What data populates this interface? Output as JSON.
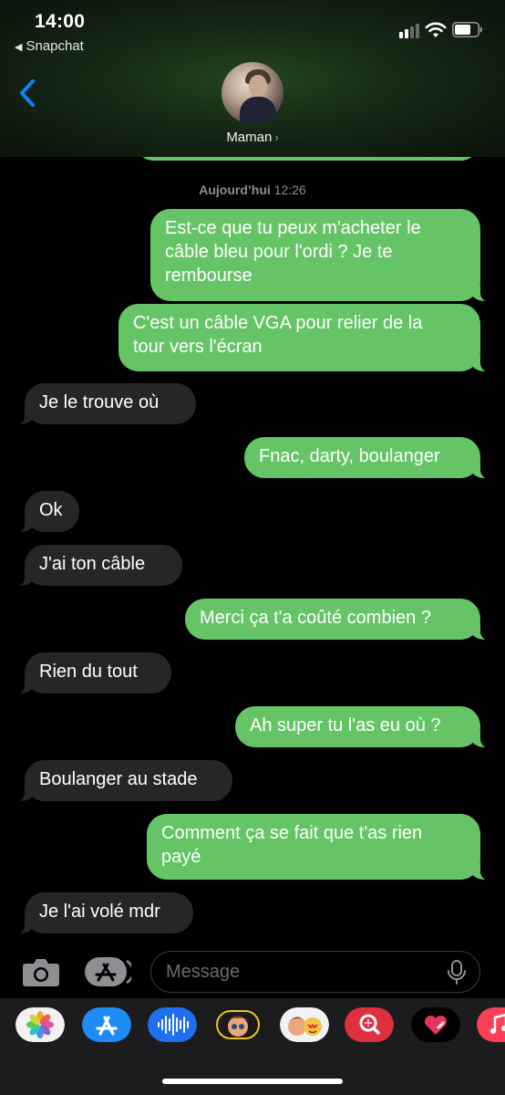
{
  "status_bar": {
    "time": "14:00",
    "back_app": "Snapchat"
  },
  "header": {
    "contact_name": "Maman",
    "chevron": "›"
  },
  "thread": {
    "timestamp_day": "Aujourd’hui",
    "timestamp_time": "12:26",
    "messages": [
      {
        "from": "me",
        "text": "Est-ce que tu peux m'acheter le\ncâble bleu pour l'ordi ? Je te\nrembourse"
      },
      {
        "from": "me",
        "text": "C'est un câble VGA pour relier de la\ntour vers l'écran"
      },
      {
        "from": "them",
        "text": "Je le trouve où"
      },
      {
        "from": "me",
        "text": "Fnac, darty, boulanger"
      },
      {
        "from": "them",
        "text": "Ok"
      },
      {
        "from": "them",
        "text": "J'ai ton câble"
      },
      {
        "from": "me",
        "text": "Merci ça t'a coûté combien ?"
      },
      {
        "from": "them",
        "text": "Rien du tout"
      },
      {
        "from": "me",
        "text": "Ah super tu l'as eu où ?"
      },
      {
        "from": "them",
        "text": "Boulanger au stade"
      },
      {
        "from": "me",
        "text": "Comment ça se fait que t'as rien\npayé"
      },
      {
        "from": "them",
        "text": "Je l'ai volé mdr"
      }
    ]
  },
  "input_bar": {
    "placeholder": "Message"
  },
  "app_drawer": {
    "apps": [
      "photos-icon",
      "app-store-icon",
      "audio-message-icon",
      "memoji-icon",
      "memoji-stickers-icon",
      "web-search-icon",
      "digital-touch-icon",
      "music-icon"
    ]
  },
  "colors": {
    "outgoing_bubble": "#65c466",
    "incoming_bubble": "#262629",
    "ios_blue": "#0a84ff",
    "background": "#000000"
  }
}
